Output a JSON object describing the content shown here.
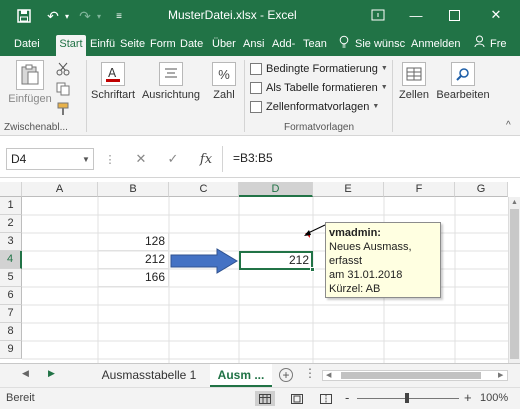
{
  "window": {
    "title": "MusterDatei.xlsx - Excel",
    "accent": "#217346"
  },
  "ribbon_tabs": [
    "Datei",
    "Start",
    "Einfü",
    "Seite",
    "Form",
    "Date",
    "Über",
    "Ansi",
    "Add-",
    "Tean"
  ],
  "tell_me": "Sie wünsc",
  "sign_in": "Anmelden",
  "share": "Fre",
  "ribbon": {
    "paste": "Einfügen",
    "clipboard_group": "Zwischenabl...",
    "font": "Schriftart",
    "alignment": "Ausrichtung",
    "number": "Zahl",
    "number_icon": "%",
    "conditional": "Bedingte Formatierung",
    "as_table": "Als Tabelle formatieren",
    "cell_styles": "Zellenformatvorlagen",
    "styles_group": "Formatvorlagen",
    "cells": "Zellen",
    "editing": "Bearbeiten"
  },
  "formula_bar": {
    "name_box": "D4",
    "fx": "fx",
    "formula": "=B3:B5"
  },
  "columns": [
    "A",
    "B",
    "C",
    "D",
    "E",
    "F",
    "G"
  ],
  "rows": [
    "1",
    "2",
    "3",
    "4",
    "5",
    "6",
    "7",
    "8",
    "9"
  ],
  "cells": {
    "B3": "128",
    "B4": "212",
    "B5": "166",
    "D4": "212"
  },
  "comment": {
    "author": "vmadmin:",
    "lines": [
      "Neues Ausmass, erfasst",
      "am 31.01.2018",
      "Kürzel: AB"
    ]
  },
  "sheets": {
    "tab1": "Ausmasstabelle 1",
    "tab2": "Ausm ...",
    "add": "+"
  },
  "status": {
    "ready": "Bereit",
    "zoom": "100%",
    "zoom_minus": "-",
    "zoom_plus": "+"
  }
}
